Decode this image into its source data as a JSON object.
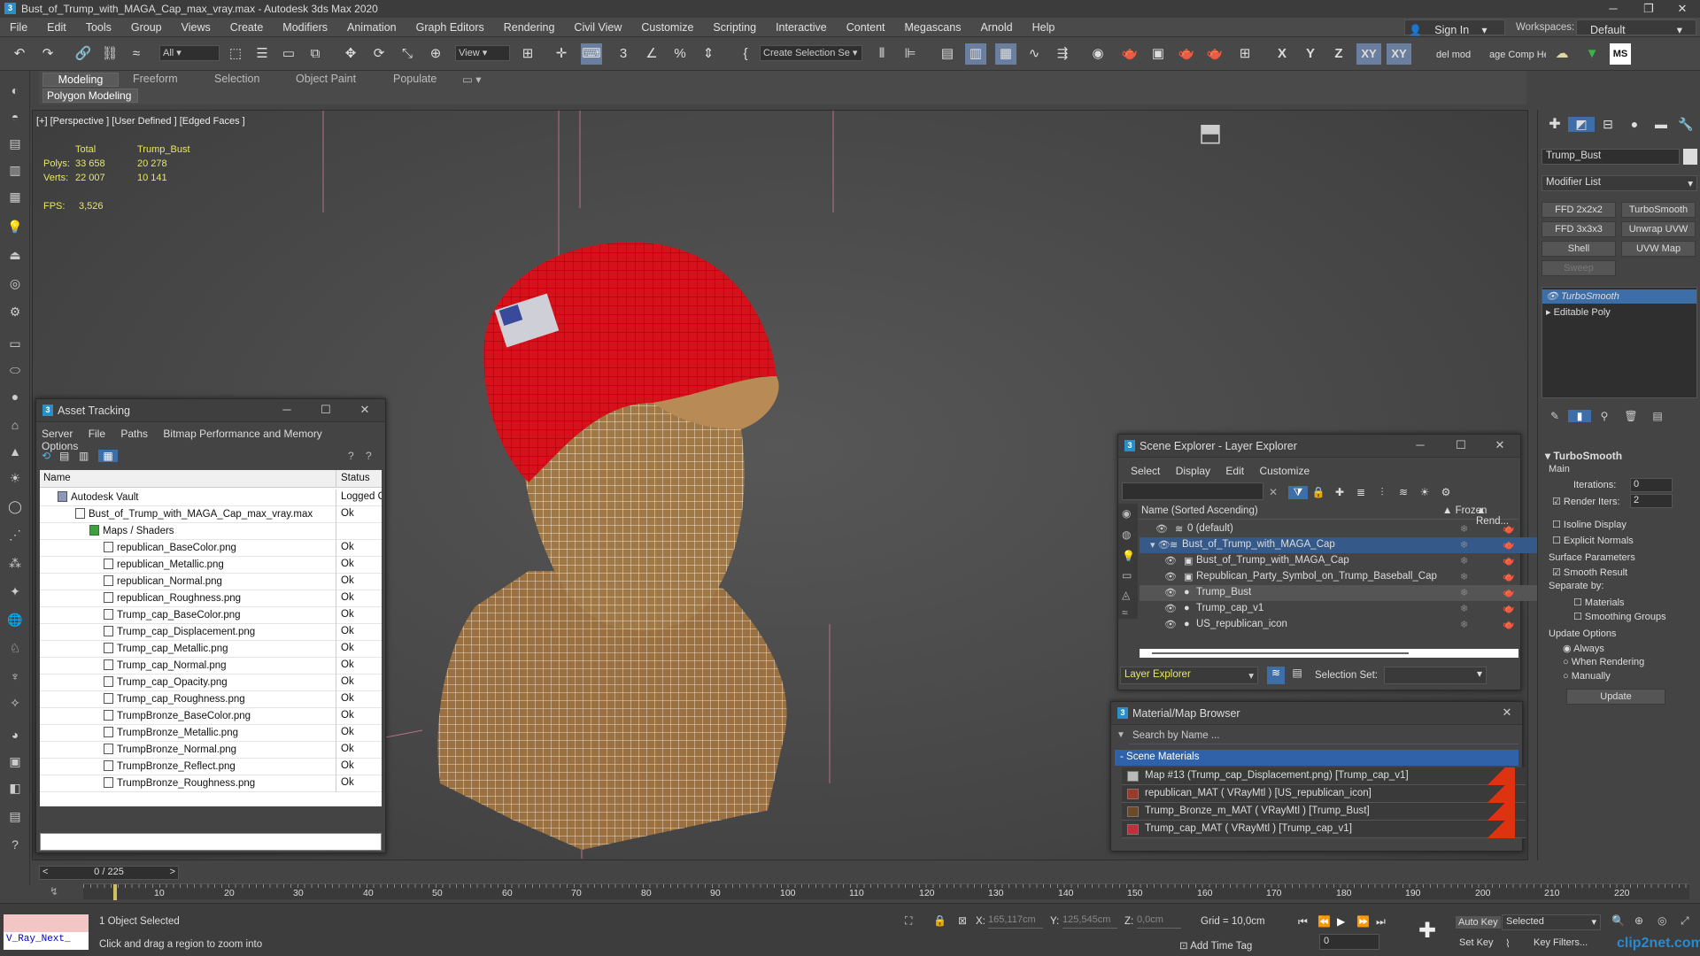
{
  "title": "Bust_of_Trump_with_MAGA_Cap_max_vray.max - Autodesk 3ds Max 2020",
  "menus": [
    "File",
    "Edit",
    "Tools",
    "Group",
    "Views",
    "Create",
    "Modifiers",
    "Animation",
    "Graph Editors",
    "Rendering",
    "Civil View",
    "Customize",
    "Scripting",
    "Interactive",
    "Content",
    "Megascans",
    "Arnold",
    "Help"
  ],
  "account": {
    "sign_in": "Sign In",
    "workspaces_label": "Workspaces:",
    "workspace": "Default"
  },
  "toolbar": {
    "filter": "All",
    "view": "View",
    "selection_set": "Create Selection Se",
    "axes": [
      "X",
      "Y",
      "Z",
      "XY",
      "XY"
    ],
    "extra1": "del mod",
    "extra2": "age Comp Hel",
    "ms": "MS"
  },
  "ribbon": {
    "tabs": [
      "Modeling",
      "Freeform",
      "Selection",
      "Object Paint",
      "Populate"
    ],
    "sub": "Polygon Modeling"
  },
  "viewport": {
    "label": "[+] [Perspective ] [User Defined ] [Edged Faces ]",
    "stats": {
      "total": "Total",
      "object": "Trump_Bust",
      "polys_label": "Polys:",
      "polys_total": "33 658",
      "polys_obj": "20 278",
      "verts_label": "Verts:",
      "verts_total": "22 007",
      "verts_obj": "10 141",
      "fps_label": "FPS:",
      "fps": "3,526"
    }
  },
  "asset_tracking": {
    "title": "Asset Tracking",
    "menu": [
      "Server",
      "File",
      "Paths",
      "Bitmap Performance and Memory",
      "Options"
    ],
    "col_name": "Name",
    "col_status": "Status",
    "rows": [
      {
        "name": "Autodesk Vault",
        "status": "Logged O"
      },
      {
        "name": "Bust_of_Trump_with_MAGA_Cap_max_vray.max",
        "status": "Ok"
      },
      {
        "name": "Maps / Shaders",
        "status": ""
      },
      {
        "name": "republican_BaseColor.png",
        "status": "Ok"
      },
      {
        "name": "republican_Metallic.png",
        "status": "Ok"
      },
      {
        "name": "republican_Normal.png",
        "status": "Ok"
      },
      {
        "name": "republican_Roughness.png",
        "status": "Ok"
      },
      {
        "name": "Trump_cap_BaseColor.png",
        "status": "Ok"
      },
      {
        "name": "Trump_cap_Displacement.png",
        "status": "Ok"
      },
      {
        "name": "Trump_cap_Metallic.png",
        "status": "Ok"
      },
      {
        "name": "Trump_cap_Normal.png",
        "status": "Ok"
      },
      {
        "name": "Trump_cap_Opacity.png",
        "status": "Ok"
      },
      {
        "name": "Trump_cap_Roughness.png",
        "status": "Ok"
      },
      {
        "name": "TrumpBronze_BaseColor.png",
        "status": "Ok"
      },
      {
        "name": "TrumpBronze_Metallic.png",
        "status": "Ok"
      },
      {
        "name": "TrumpBronze_Normal.png",
        "status": "Ok"
      },
      {
        "name": "TrumpBronze_Reflect.png",
        "status": "Ok"
      },
      {
        "name": "TrumpBronze_Roughness.png",
        "status": "Ok"
      }
    ]
  },
  "scene_explorer": {
    "title": "Scene Explorer - Layer Explorer",
    "menu": [
      "Select",
      "Display",
      "Edit",
      "Customize"
    ],
    "col_name": "Name (Sorted Ascending)",
    "col_frozen": "▲ Frozen",
    "col_render": "▲ Rend...",
    "rows": [
      {
        "name": "0 (default)"
      },
      {
        "name": "Bust_of_Trump_with_MAGA_Cap"
      },
      {
        "name": "Bust_of_Trump_with_MAGA_Cap"
      },
      {
        "name": "Republican_Party_Symbol_on_Trump_Baseball_Cap"
      },
      {
        "name": "Trump_Bust"
      },
      {
        "name": "Trump_cap_v1"
      },
      {
        "name": "US_republican_icon"
      }
    ],
    "footer_layer": "Layer Explorer",
    "footer_selset": "Selection Set:"
  },
  "material_browser": {
    "title": "Material/Map Browser",
    "search": "Search by Name ...",
    "group": "- Scene Materials",
    "rows": [
      {
        "name": "Map #13 (Trump_cap_Displacement.png) [Trump_cap_v1]",
        "color": "#bbbbbb"
      },
      {
        "name": "republican_MAT ( VRayMtl ) [US_republican_icon]",
        "color": "#9a3a2a"
      },
      {
        "name": "Trump_Bronze_m_MAT ( VRayMtl ) [Trump_Bust]",
        "color": "#6a4a2a"
      },
      {
        "name": "Trump_cap_MAT ( VRayMtl ) [Trump_cap_v1]",
        "color": "#c0303a"
      }
    ]
  },
  "command_panel": {
    "object_name": "Trump_Bust",
    "modifier_list": "Modifier List",
    "buttons": [
      "FFD 2x2x2",
      "TurboSmooth",
      "FFD 3x3x3",
      "Unwrap UVW",
      "Shell",
      "UVW Map",
      "Sweep"
    ],
    "stack": [
      "TurboSmooth",
      "Editable Poly"
    ],
    "rollout": "TurboSmooth",
    "main": "Main",
    "iterations_label": "Iterations:",
    "iterations": "0",
    "render_iters_label": "Render Iters:",
    "render_iters": "2",
    "isoline": "Isoline Display",
    "explicit": "Explicit Normals",
    "surface": "Surface Parameters",
    "smooth": "Smooth Result",
    "separate": "Separate by:",
    "materials": "Materials",
    "smoothing": "Smoothing Groups",
    "update_opts": "Update Options",
    "always": "Always",
    "when_rendering": "When Rendering",
    "manually": "Manually",
    "update_btn": "Update"
  },
  "timeline": {
    "counter": "0 / 225",
    "ticks": [
      "10",
      "20",
      "30",
      "40",
      "50",
      "60",
      "70",
      "80",
      "90",
      "100",
      "110",
      "120",
      "130",
      "140",
      "150",
      "160",
      "170",
      "180",
      "190",
      "200",
      "210",
      "220"
    ]
  },
  "statusbar": {
    "script": "V_Ray_Next_",
    "selected": "1 Object Selected",
    "hint": "Click and drag a region to zoom into",
    "x_label": "X:",
    "x": "165,117cm",
    "y_label": "Y:",
    "y": "125,545cm",
    "z_label": "Z:",
    "z": "0,0cm",
    "grid": "Grid = 10,0cm",
    "add_time_tag": "Add Time Tag",
    "auto_key": "Auto Key",
    "selected_dd": "Selected",
    "set_key": "Set Key",
    "key_filters": "Key Filters...",
    "frame": "0",
    "watermark": "clip2net.com"
  }
}
